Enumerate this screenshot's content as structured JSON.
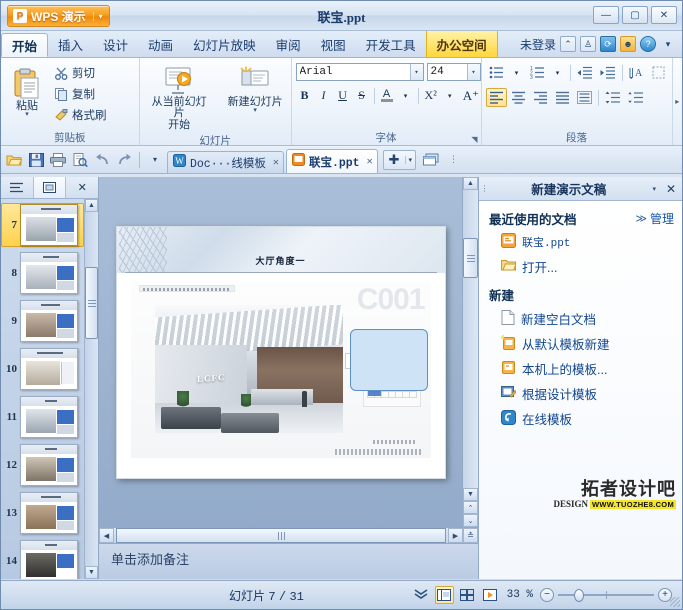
{
  "titlebar": {
    "app_button": "WPS 演示",
    "app_logo_glyph": "P",
    "document_title": "联宝.ppt",
    "minimize": "—",
    "maximize": "▢",
    "close": "✕"
  },
  "menubar": {
    "tabs": [
      {
        "label": "开始",
        "state": "active"
      },
      {
        "label": "插入",
        "state": "normal"
      },
      {
        "label": "设计",
        "state": "normal"
      },
      {
        "label": "动画",
        "state": "normal"
      },
      {
        "label": "幻灯片放映",
        "state": "normal"
      },
      {
        "label": "审阅",
        "state": "normal"
      },
      {
        "label": "视图",
        "state": "normal"
      },
      {
        "label": "开发工具",
        "state": "normal"
      },
      {
        "label": "办公空间",
        "state": "highlight"
      }
    ],
    "account_status": "未登录",
    "icons": [
      "collapse-ribbon-icon",
      "tshirt-skin-icon",
      "wps-cloud-icon",
      "avatar-icon",
      "help-icon",
      "more-icon"
    ]
  },
  "ribbon": {
    "clipboard": {
      "group_title": "剪贴板",
      "paste_label": "粘贴",
      "paste_arrow": "▾",
      "cut_label": "剪切",
      "copy_label": "复制",
      "format_painter_label": "格式刷"
    },
    "slides": {
      "group_title": "幻灯片",
      "from_current_label": "从当前幻灯片",
      "from_current_label2": "开始",
      "from_current_arrow": "▾",
      "new_slide_label": "新建幻灯片",
      "new_slide_arrow": "▾"
    },
    "font": {
      "group_title": "字体",
      "font_name": "Arial",
      "font_size": "24",
      "dropdown_caret": "▾",
      "bold": "B",
      "italic": "I",
      "underline": "U",
      "strikethrough": "S",
      "text_color": "A",
      "superscript": "X²",
      "grow_font": "A⁺",
      "shrink_font": "A⁻",
      "dialog_launcher": "◥"
    },
    "paragraph": {
      "group_title": "段落",
      "bullets": "▤",
      "numbering": "⒈",
      "decrease_indent": "⇤",
      "increase_indent": "⇥",
      "text_direction": "⇅A",
      "align_left": "≡",
      "align_center": "≡",
      "align_right": "≡",
      "justify": "≡",
      "distribute": "≡",
      "line_spacing": "↕",
      "paragraph_spacing": "↕",
      "more_arrow": "▸"
    }
  },
  "tabbar": {
    "quick_access": [
      "open-icon",
      "save-icon",
      "print-icon",
      "print-preview-icon",
      "undo-icon",
      "redo-icon",
      "customize-qa-icon"
    ],
    "tabs": [
      {
        "label": "Doc···线模板",
        "icon": "wps-writer-icon",
        "active": false,
        "close": "✕"
      },
      {
        "label": "联宝.ppt",
        "icon": "wps-presentation-icon",
        "active": true,
        "close": "✕"
      }
    ],
    "new_tab": "✚",
    "new_tab_caret": "▾",
    "window_list_icon": "window-list-icon"
  },
  "slide_panel": {
    "outline_view_tab": "outline-view-icon",
    "slides_view_tab": "slides-view-icon",
    "close": "✕",
    "thumbnails": [
      {
        "number": "7",
        "selected": true
      },
      {
        "number": "8",
        "selected": false
      },
      {
        "number": "9",
        "selected": false
      },
      {
        "number": "10",
        "selected": false
      },
      {
        "number": "11",
        "selected": false
      },
      {
        "number": "12",
        "selected": false
      },
      {
        "number": "13",
        "selected": false
      },
      {
        "number": "14",
        "selected": false
      }
    ],
    "scroll_up": "▲",
    "scroll_down": "▼"
  },
  "slide": {
    "title": "大厅角度一",
    "watermark_code": "C001",
    "logo_text": "LCFC",
    "header_company": "联宝（合肥）电子科技有限公司",
    "callout_present": true,
    "footer_company": "昆山市华尔星建装饰有限责任公司"
  },
  "notes": {
    "placeholder": "单击添加备注"
  },
  "taskpane": {
    "title": "新建演示文稿",
    "caret": "▾",
    "close": "✕",
    "recent_section": "最近使用的文档",
    "manage_arrow": "≫",
    "manage_label": "管理",
    "recent_items": [
      {
        "label": "联宝.ppt",
        "icon": "ppt-file-icon"
      },
      {
        "label": "打开...",
        "icon": "open-folder-icon"
      }
    ],
    "new_section": "新建",
    "new_items": [
      {
        "label": "新建空白文档",
        "icon": "blank-document-icon"
      },
      {
        "label": "从默认模板新建",
        "icon": "default-template-icon"
      },
      {
        "label": "本机上的模板...",
        "icon": "local-template-icon"
      },
      {
        "label": "根据设计模板",
        "icon": "design-template-icon"
      },
      {
        "label": "在线模板",
        "icon": "online-template-icon"
      }
    ]
  },
  "watermark": {
    "line1": "拓者设计吧",
    "design": "DESIGN",
    "url": "WWW.TUOZHE8.COM"
  },
  "statusbar": {
    "slide_label": "幻灯片",
    "current_slide": "7",
    "separator": "/",
    "total_slides": "31",
    "collapse_icon": "▼▼",
    "view_normal": "normal-view-icon",
    "view_sorter": "slide-sorter-icon",
    "view_show": "slideshow-icon",
    "zoom_value": "33 %",
    "zoom_out": "−",
    "zoom_in": "+"
  },
  "scrollbars": {
    "up": "▲",
    "down": "▼",
    "left": "◀",
    "right": "▶",
    "prev_slide": "⌃",
    "next_slide": "⌄"
  },
  "colors": {
    "accent_orange": "#f79c1e",
    "highlight_yellow": "#ffd63d",
    "link_blue": "#13468f",
    "title_blue": "#16355c"
  }
}
